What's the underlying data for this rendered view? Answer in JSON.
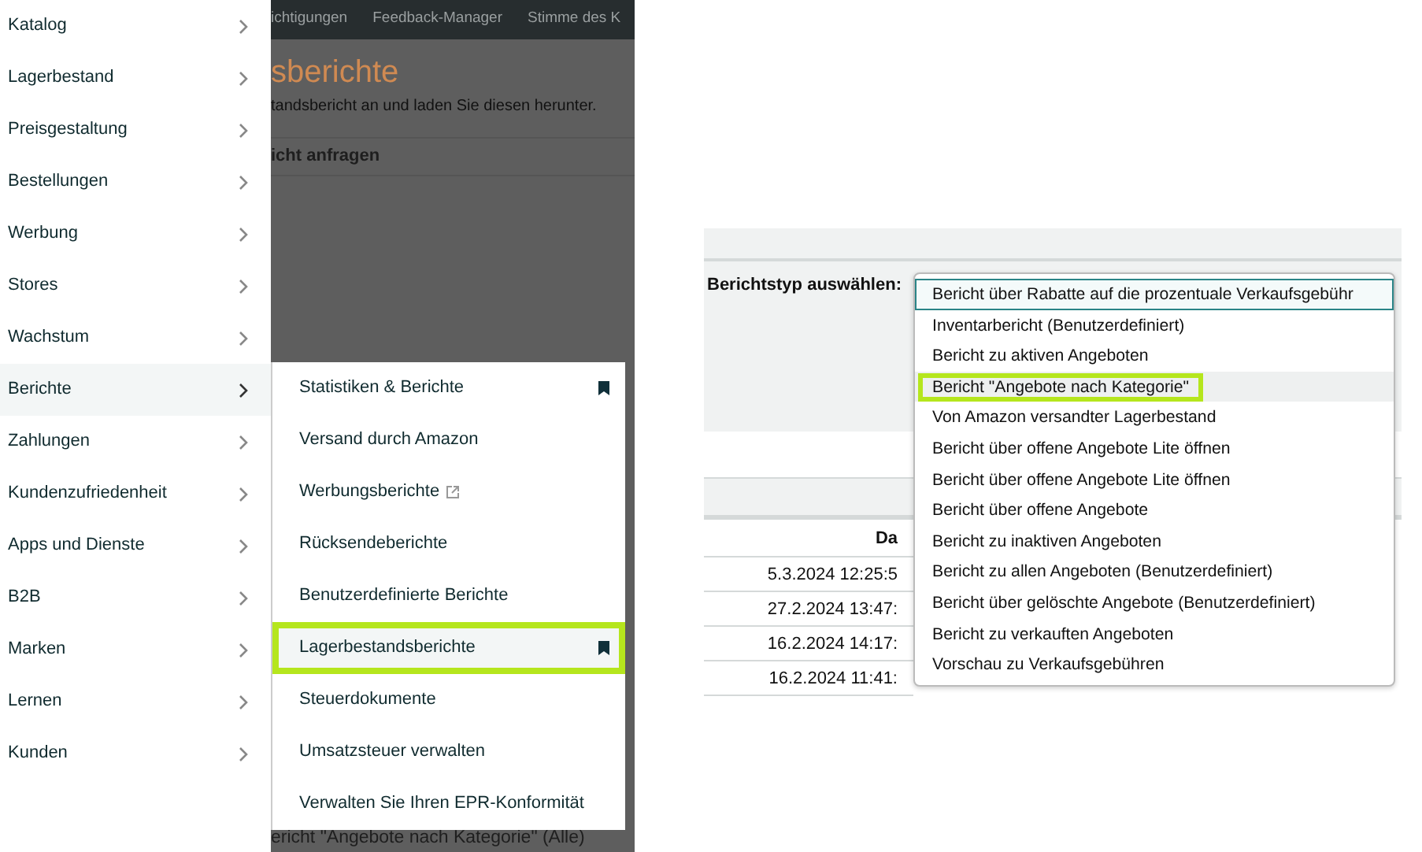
{
  "background_page": {
    "nav_tabs": [
      "ichtigungen",
      "Feedback-Manager",
      "Stimme des K"
    ],
    "heading": "sberichte",
    "description": "tandsbericht an und laden Sie diesen herunter.",
    "section_title": "icht anfragen",
    "footer_text": "ericht \"Angebote nach Kategorie\" (Alle)"
  },
  "sidebar": {
    "items": [
      {
        "label": "Katalog",
        "selected": false
      },
      {
        "label": "Lagerbestand",
        "selected": false
      },
      {
        "label": "Preisgestaltung",
        "selected": false
      },
      {
        "label": "Bestellungen",
        "selected": false
      },
      {
        "label": "Werbung",
        "selected": false
      },
      {
        "label": "Stores",
        "selected": false
      },
      {
        "label": "Wachstum",
        "selected": false
      },
      {
        "label": "Berichte",
        "selected": true
      },
      {
        "label": "Zahlungen",
        "selected": false
      },
      {
        "label": "Kundenzufriedenheit",
        "selected": false
      },
      {
        "label": "Apps und Dienste",
        "selected": false
      },
      {
        "label": "B2B",
        "selected": false
      },
      {
        "label": "Marken",
        "selected": false
      },
      {
        "label": "Lernen",
        "selected": false
      },
      {
        "label": "Kunden",
        "selected": false
      }
    ]
  },
  "submenu": {
    "items": [
      {
        "label": "Statistiken & Berichte",
        "bookmarked": true,
        "external": false,
        "selected": false,
        "highlighted": false
      },
      {
        "label": "Versand durch Amazon",
        "bookmarked": false,
        "external": false,
        "selected": false,
        "highlighted": false
      },
      {
        "label": "Werbungsberichte",
        "bookmarked": false,
        "external": true,
        "selected": false,
        "highlighted": false
      },
      {
        "label": "Rücksendeberichte",
        "bookmarked": false,
        "external": false,
        "selected": false,
        "highlighted": false
      },
      {
        "label": "Benutzerdefinierte Berichte",
        "bookmarked": false,
        "external": false,
        "selected": false,
        "highlighted": false
      },
      {
        "label": "Lagerbestandsberichte",
        "bookmarked": true,
        "external": false,
        "selected": true,
        "highlighted": true
      },
      {
        "label": "Steuerdokumente",
        "bookmarked": false,
        "external": false,
        "selected": false,
        "highlighted": false
      },
      {
        "label": "Umsatzsteuer verwalten",
        "bookmarked": false,
        "external": false,
        "selected": false,
        "highlighted": false
      },
      {
        "label": "Verwalten Sie Ihren EPR-Konformität",
        "bookmarked": false,
        "external": false,
        "selected": false,
        "highlighted": false
      }
    ]
  },
  "report_panel": {
    "label": "Berichtstyp auswählen:",
    "dropdown": {
      "options": [
        {
          "label": "Bericht über Rabatte auf die prozentuale Verkaufsgebühr",
          "focused": true,
          "hovered": false,
          "highlighted": false
        },
        {
          "label": "Inventarbericht (Benutzerdefiniert)",
          "focused": false,
          "hovered": false,
          "highlighted": false
        },
        {
          "label": "Bericht zu aktiven Angeboten",
          "focused": false,
          "hovered": false,
          "highlighted": false
        },
        {
          "label": "Bericht \"Angebote nach Kategorie\"",
          "focused": false,
          "hovered": true,
          "highlighted": true
        },
        {
          "label": "Von Amazon versandter Lagerbestand",
          "focused": false,
          "hovered": false,
          "highlighted": false
        },
        {
          "label": "Bericht über offene Angebote Lite öffnen",
          "focused": false,
          "hovered": false,
          "highlighted": false
        },
        {
          "label": "Bericht über offene Angebote Lite öffnen",
          "focused": false,
          "hovered": false,
          "highlighted": false
        },
        {
          "label": "Bericht über offene Angebote",
          "focused": false,
          "hovered": false,
          "highlighted": false
        },
        {
          "label": "Bericht zu inaktiven Angeboten",
          "focused": false,
          "hovered": false,
          "highlighted": false
        },
        {
          "label": "Bericht zu allen Angeboten (Benutzerdefiniert)",
          "focused": false,
          "hovered": false,
          "highlighted": false
        },
        {
          "label": "Bericht über gelöschte Angebote (Benutzerdefiniert)",
          "focused": false,
          "hovered": false,
          "highlighted": false
        },
        {
          "label": "Bericht zu verkauften Angeboten",
          "focused": false,
          "hovered": false,
          "highlighted": false
        },
        {
          "label": "Vorschau zu Verkaufsgebühren",
          "focused": false,
          "hovered": false,
          "highlighted": false
        }
      ]
    },
    "table": {
      "header": "Da",
      "rows": [
        "5.3.2024 12:25:5",
        "27.2.2024 13:47:",
        "16.2.2024 14:17:",
        "16.2.2024 11:41:"
      ]
    }
  }
}
